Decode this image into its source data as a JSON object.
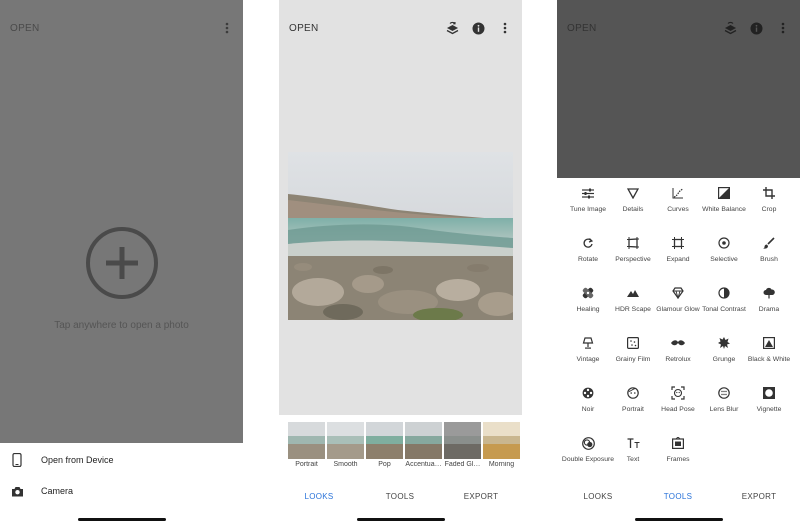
{
  "screen1": {
    "open_label": "OPEN",
    "hint": "Tap anywhere to open a photo",
    "sheet": [
      {
        "label": "Open from Device",
        "icon": "phone-icon"
      },
      {
        "label": "Camera",
        "icon": "camera-icon"
      }
    ]
  },
  "screen2": {
    "open_label": "OPEN",
    "looks": [
      {
        "label": "Portrait"
      },
      {
        "label": "Smooth"
      },
      {
        "label": "Pop"
      },
      {
        "label": "Accentua…"
      },
      {
        "label": "Faded Gl…"
      },
      {
        "label": "Morning"
      }
    ],
    "nav": {
      "looks": "LOOKS",
      "tools": "TOOLS",
      "export": "EXPORT",
      "active": "looks"
    }
  },
  "screen3": {
    "open_label": "OPEN",
    "tools": [
      {
        "label": "Tune Image",
        "icon": "sliders-icon"
      },
      {
        "label": "Details",
        "icon": "triangle-icon"
      },
      {
        "label": "Curves",
        "icon": "curves-icon"
      },
      {
        "label": "White Balance",
        "icon": "white-balance-icon"
      },
      {
        "label": "Crop",
        "icon": "crop-icon"
      },
      {
        "label": "Rotate",
        "icon": "rotate-icon"
      },
      {
        "label": "Perspective",
        "icon": "perspective-icon"
      },
      {
        "label": "Expand",
        "icon": "expand-icon"
      },
      {
        "label": "Selective",
        "icon": "selective-icon"
      },
      {
        "label": "Brush",
        "icon": "brush-icon"
      },
      {
        "label": "Healing",
        "icon": "bandage-icon"
      },
      {
        "label": "HDR Scape",
        "icon": "mountain-icon"
      },
      {
        "label": "Glamour Glow",
        "icon": "diamond-icon"
      },
      {
        "label": "Tonal Contrast",
        "icon": "half-circle-icon"
      },
      {
        "label": "Drama",
        "icon": "cloud-icon"
      },
      {
        "label": "Vintage",
        "icon": "lamp-icon"
      },
      {
        "label": "Grainy Film",
        "icon": "film-icon"
      },
      {
        "label": "Retrolux",
        "icon": "mustache-icon"
      },
      {
        "label": "Grunge",
        "icon": "grunge-icon"
      },
      {
        "label": "Black & White",
        "icon": "black-white-icon"
      },
      {
        "label": "Noir",
        "icon": "film-reel-icon"
      },
      {
        "label": "Portrait",
        "icon": "face-icon"
      },
      {
        "label": "Head Pose",
        "icon": "head-pose-icon"
      },
      {
        "label": "Lens Blur",
        "icon": "lens-blur-icon"
      },
      {
        "label": "Vignette",
        "icon": "vignette-icon"
      },
      {
        "label": "Double Exposure",
        "icon": "double-exposure-icon"
      },
      {
        "label": "Text",
        "icon": "text-icon"
      },
      {
        "label": "Frames",
        "icon": "frames-icon"
      }
    ],
    "nav": {
      "looks": "LOOKS",
      "tools": "TOOLS",
      "export": "EXPORT",
      "active": "tools"
    }
  },
  "colors": {
    "accent": "#2a73d9",
    "overlay": "#777777",
    "canvas": "#e2e2e2"
  }
}
